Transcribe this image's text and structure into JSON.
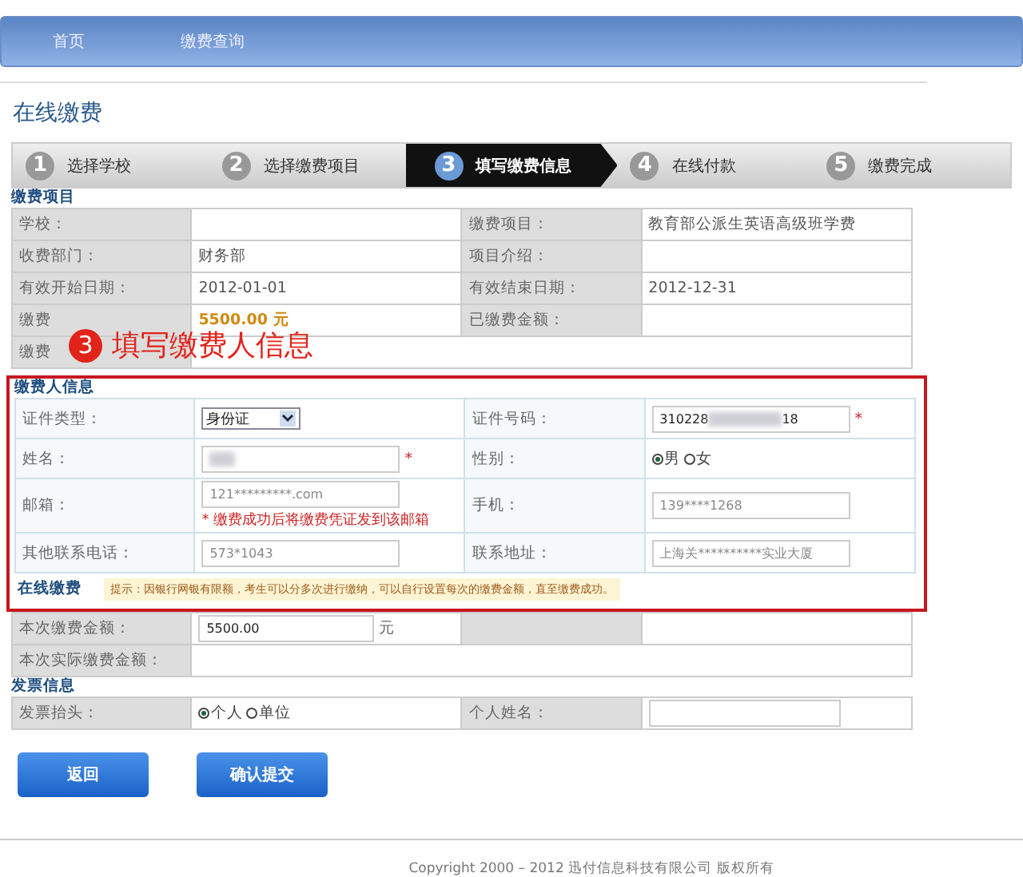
{
  "nav": [
    "首页",
    "缴费查询"
  ],
  "page_title": "在线缴费",
  "steps": [
    {
      "num": "1",
      "label": "选择学校",
      "selected": false
    },
    {
      "num": "2",
      "label": "选择缴费项目",
      "selected": false
    },
    {
      "num": "3",
      "label": "填写缴费信息",
      "selected": true
    },
    {
      "num": "4",
      "label": "在线付款",
      "selected": false
    },
    {
      "num": "5",
      "label": "缴费完成",
      "selected": false
    }
  ],
  "item_section": {
    "title": "缴费项目",
    "rows": [
      [
        {
          "label": "学校："
        },
        {
          "label": "缴费项目：",
          "value": "教育部公派生英语高级班学费"
        }
      ],
      [
        {
          "label": "收费部门：",
          "value": "财务部"
        },
        {
          "label": "项目介绍："
        }
      ],
      [
        {
          "label": "有效开始日期：",
          "value": "2012-01-01"
        },
        {
          "label": "有效结束日期：",
          "value": "2012-12-31"
        }
      ],
      [
        {
          "label": "缴费",
          "value": "5500.00 元",
          "highlight": true
        },
        {
          "label": "已缴费金额："
        }
      ],
      [
        {
          "label": "缴费"
        }
      ]
    ]
  },
  "annotation": {
    "num": "3",
    "text": "填写缴费人信息"
  },
  "payer_section": {
    "title": "缴费人信息",
    "id_type": {
      "label": "证件类型：",
      "value": "身份证"
    },
    "id_number": {
      "label": "证件号码：",
      "prefix": "310228",
      "suffix": "18",
      "redacted": true,
      "required": "*"
    },
    "name": {
      "label": "姓名：",
      "redacted": true,
      "required": "*"
    },
    "gender": {
      "label": "性别：",
      "options": [
        {
          "label": "男",
          "selected": true
        },
        {
          "label": "女",
          "selected": false
        }
      ]
    },
    "email": {
      "label": "邮箱：",
      "value": "121*********.com",
      "note": "* 缴费成功后将缴费凭证发到该邮箱"
    },
    "mobile": {
      "label": "手机：",
      "value": "139****1268"
    },
    "other_phone": {
      "label": "其他联系电话：",
      "value": "573*1043"
    },
    "address": {
      "label": "联系地址：",
      "value": "上海关**********实业大厦"
    }
  },
  "online_section": {
    "title": "在线缴费",
    "hint": "提示：因银行网银有限额，考生可以分多次进行缴纳，可以自行设置每次的缴费金额，直至缴费成功。",
    "amount": {
      "label": "本次缴费金额：",
      "value": "5500.00",
      "unit": "元"
    },
    "actual": {
      "label": "本次实际缴费金额："
    }
  },
  "invoice_section": {
    "title": "发票信息",
    "type_label": "发票抬头：",
    "options": [
      {
        "label": "个人",
        "selected": true
      },
      {
        "label": "单位",
        "selected": false
      }
    ],
    "name_label": "个人姓名："
  },
  "buttons": [
    "返回",
    "确认提交"
  ],
  "copyright": "Copyright 2000 – 2012 迅付信息科技有限公司 版权所有"
}
